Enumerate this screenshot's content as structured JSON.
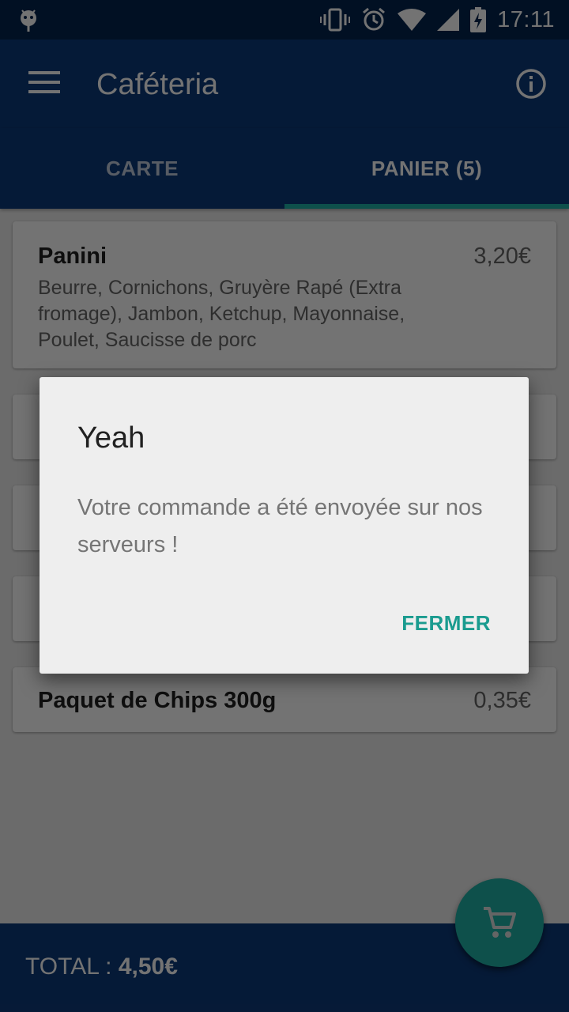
{
  "status_bar": {
    "time": "17:11",
    "icons": [
      "android-icon",
      "vibrate-icon",
      "alarm-icon",
      "wifi-icon",
      "signal-icon",
      "battery-charging-icon"
    ]
  },
  "app_bar": {
    "title": "Caféteria",
    "menu_icon": "menu-icon",
    "info_icon": "info-icon"
  },
  "tabs": [
    {
      "label": "CARTE",
      "selected": false
    },
    {
      "label": "PANIER (5)",
      "selected": true
    }
  ],
  "cart_items": [
    {
      "name": "Panini",
      "price": "3,20€",
      "description": "Beurre, Cornichons, Gruyère Rapé (Extra fromage), Jambon, Ketchup, Mayonnaise, Poulet, Saucisse de porc"
    },
    {
      "name": "",
      "price": "",
      "description": ""
    },
    {
      "name": "",
      "price": "",
      "description": ""
    },
    {
      "name": "",
      "price": "",
      "description": ""
    },
    {
      "name": "Paquet de Chips 300g",
      "price": "0,35€",
      "description": ""
    }
  ],
  "footer": {
    "total_label": "TOTAL :",
    "total_value": "4,50€"
  },
  "fab": {
    "icon": "cart-icon"
  },
  "dialog": {
    "title": "Yeah",
    "message": "Votre commande a été envoyée sur nos serveurs !",
    "button_label": "FERMER"
  },
  "colors": {
    "primary": "#0d3a7a",
    "primary_dark": "#04244f",
    "accent": "#1fb2a6"
  }
}
